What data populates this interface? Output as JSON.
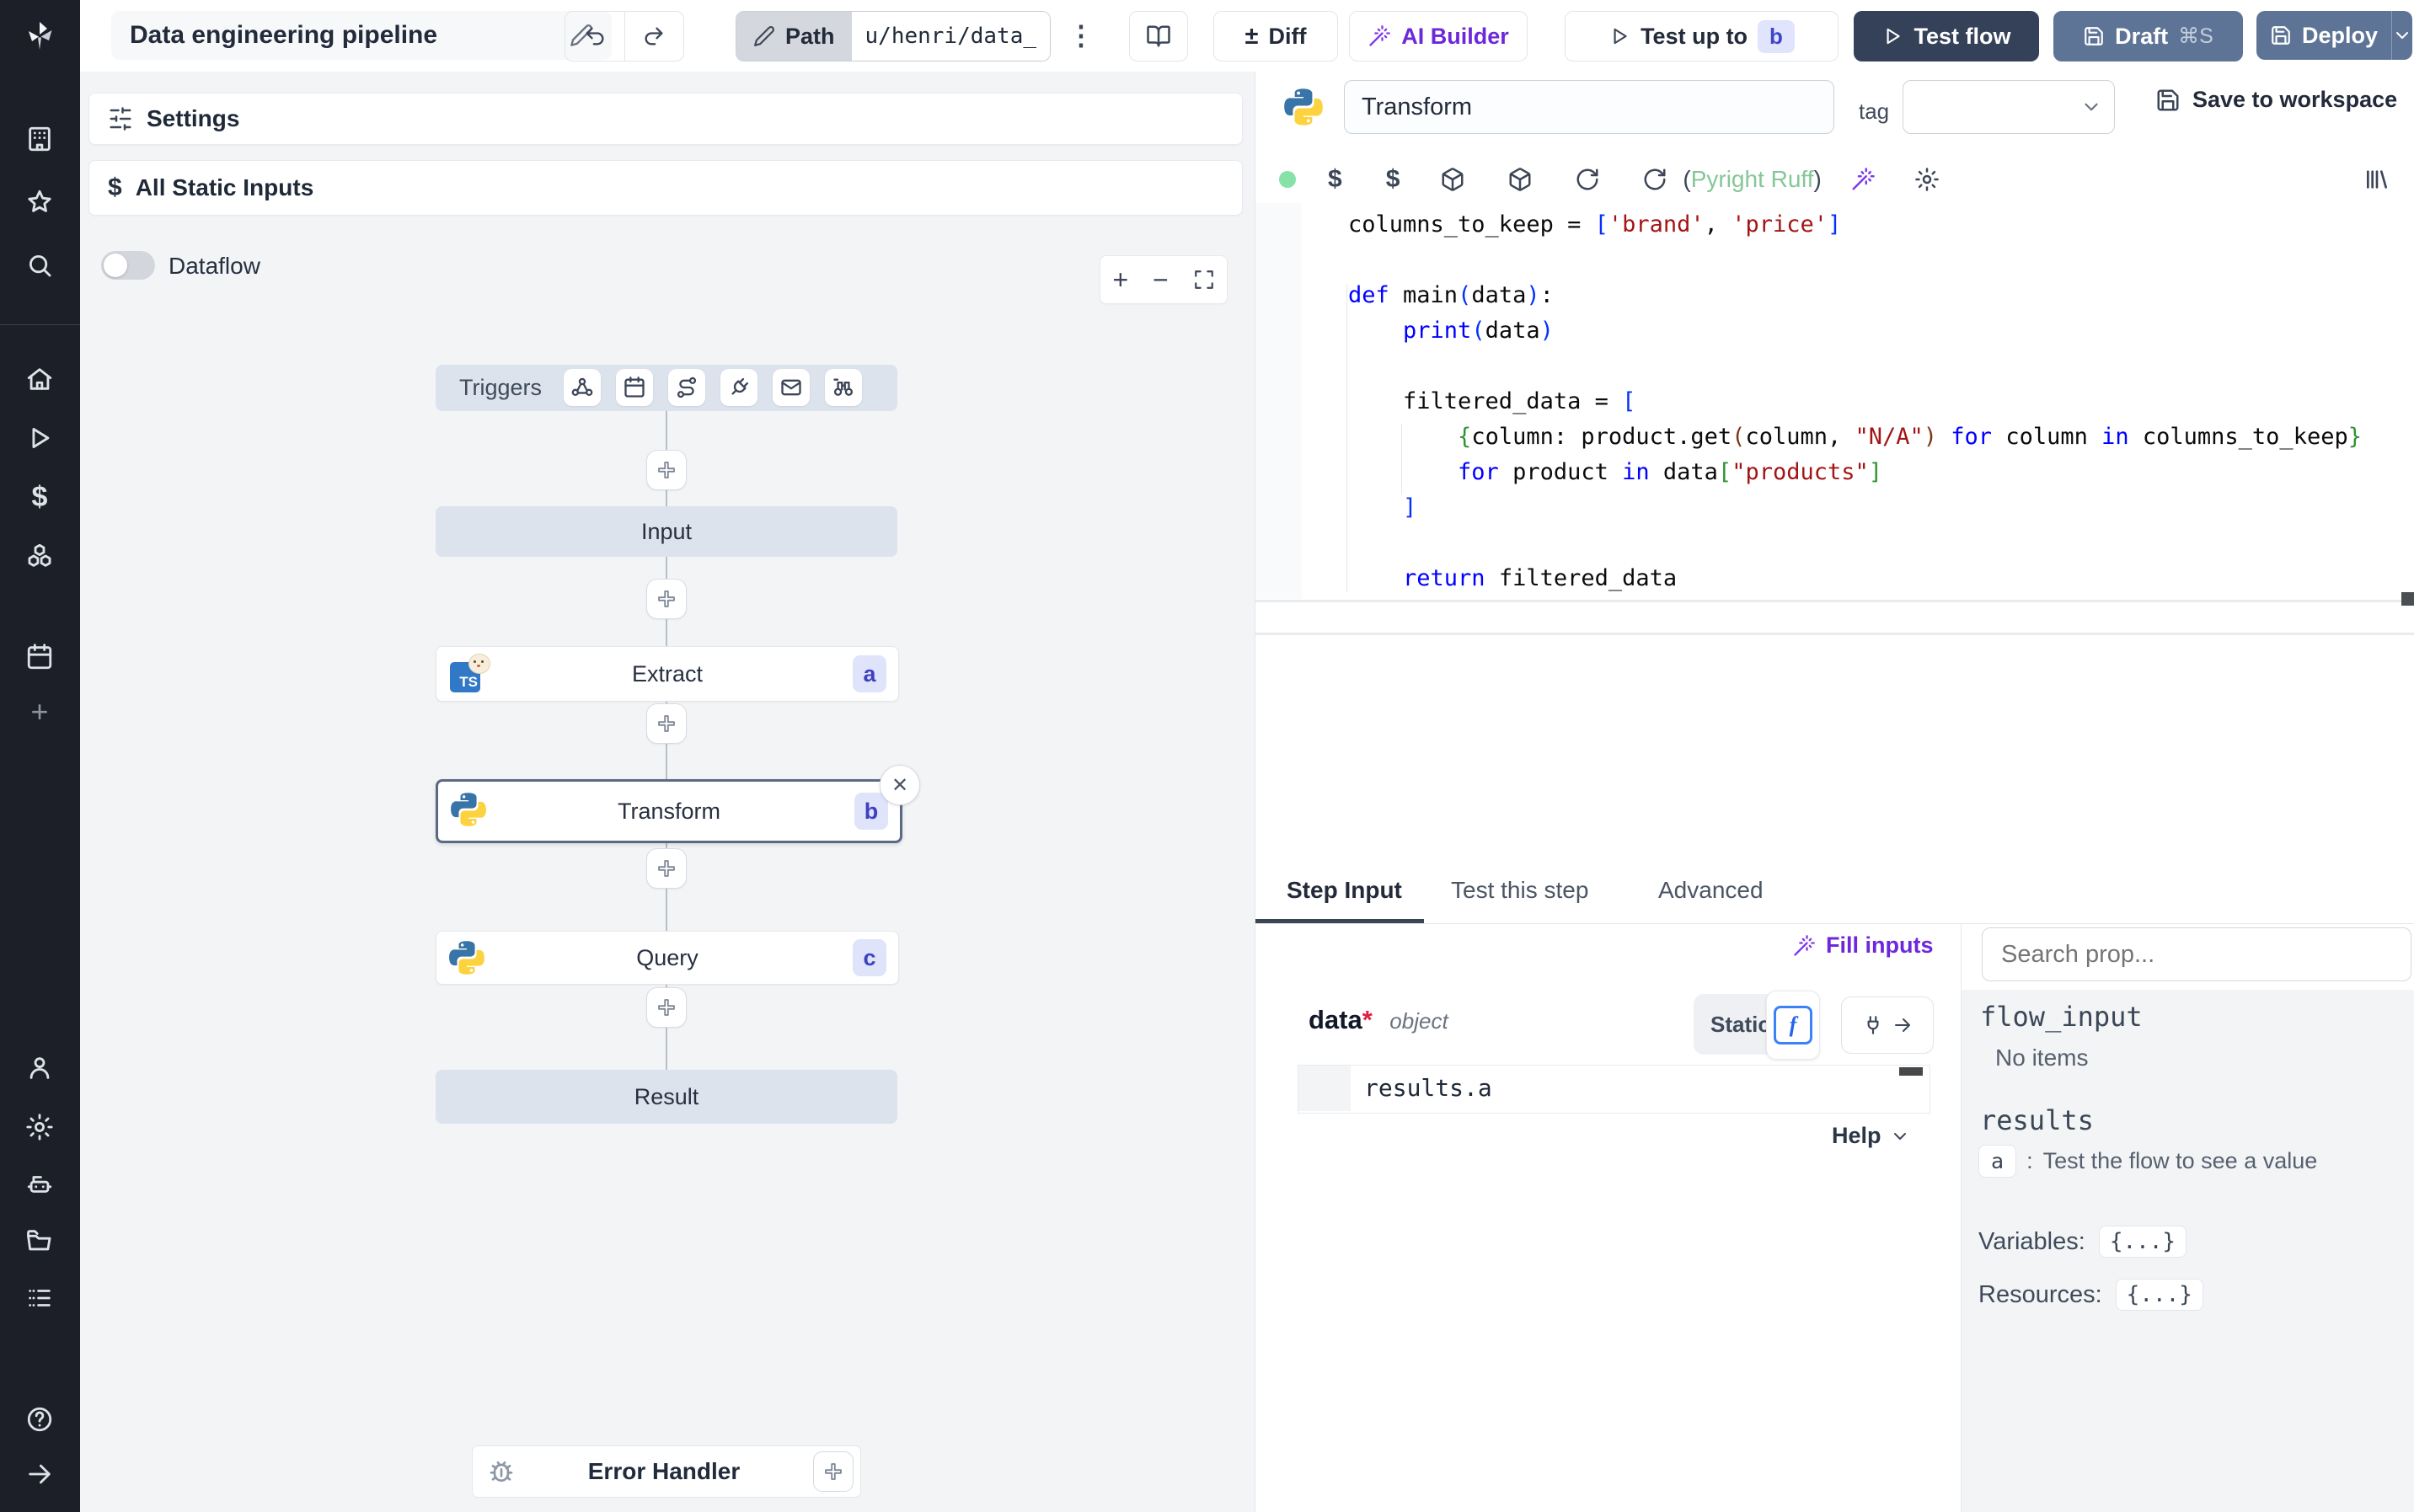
{
  "topbar": {
    "title": "Data engineering pipeline",
    "path_label": "Path",
    "path_value": "u/henri/data_",
    "diff": "Diff",
    "ai_builder": "AI Builder",
    "test_up_to": "Test up to",
    "test_up_to_badge": "b",
    "test_flow": "Test flow",
    "draft": "Draft",
    "draft_shortcut": "⌘S",
    "deploy": "Deploy"
  },
  "sidebar": {
    "icons": [
      "windmill-logo",
      "workspace-building",
      "favorites-star",
      "search",
      "home",
      "runs-play",
      "variables-dollar",
      "resources-cubes",
      "schedules-calendar",
      "add-plus",
      "user",
      "settings-gear",
      "workers-robot",
      "folders",
      "audit-list",
      "help",
      "expand-arrow"
    ]
  },
  "flow": {
    "settings": "Settings",
    "all_static_inputs": "All Static Inputs",
    "dataflow": "Dataflow",
    "triggers_label": "Triggers",
    "trigger_icons": [
      "webhook",
      "schedule-calendar",
      "http-route",
      "websocket-plug",
      "email",
      "scheduled-poll-binoculars"
    ],
    "nodes": {
      "input": "Input",
      "extract": "Extract",
      "extract_badge": "a",
      "transform": "Transform",
      "transform_badge": "b",
      "query": "Query",
      "query_badge": "c",
      "result": "Result"
    },
    "error_handler": "Error Handler"
  },
  "editor": {
    "step_name": "Transform",
    "tag_label": "tag",
    "save_label": "Save to workspace",
    "lint": {
      "open": "(",
      "text": "Pyright Ruff",
      "close": ")"
    },
    "code": [
      [
        [
          "p",
          "columns_to_keep = "
        ],
        [
          "b1",
          "["
        ],
        [
          "s",
          "'brand'"
        ],
        [
          "p",
          ", "
        ],
        [
          "s",
          "'price'"
        ],
        [
          "b1",
          "]"
        ]
      ],
      [],
      [
        [
          "k",
          "def"
        ],
        [
          "p",
          " main"
        ],
        [
          "b1",
          "("
        ],
        [
          "p",
          "data"
        ],
        [
          "b1",
          ")"
        ],
        [
          "p",
          ":"
        ]
      ],
      [
        [
          "p",
          "    "
        ],
        [
          "k",
          "print"
        ],
        [
          "b1",
          "("
        ],
        [
          "p",
          "data"
        ],
        [
          "b1",
          ")"
        ]
      ],
      [],
      [
        [
          "p",
          "    filtered_data = "
        ],
        [
          "b1",
          "["
        ]
      ],
      [
        [
          "p",
          "        "
        ],
        [
          "b2",
          "{"
        ],
        [
          "p",
          "column: product.get"
        ],
        [
          "b3",
          "("
        ],
        [
          "p",
          "column, "
        ],
        [
          "s",
          "\"N/A\""
        ],
        [
          "b3",
          ")"
        ],
        [
          "k",
          " for"
        ],
        [
          "p",
          " column "
        ],
        [
          "k",
          "in"
        ],
        [
          "p",
          " columns_to_keep"
        ],
        [
          "b2",
          "}"
        ]
      ],
      [
        [
          "p",
          "        "
        ],
        [
          "k",
          "for"
        ],
        [
          "p",
          " product "
        ],
        [
          "k",
          "in"
        ],
        [
          "p",
          " data"
        ],
        [
          "b2",
          "["
        ],
        [
          "s",
          "\"products\""
        ],
        [
          "b2",
          "]"
        ]
      ],
      [
        [
          "p",
          "    "
        ],
        [
          "b1",
          "]"
        ]
      ],
      [],
      [
        [
          "p",
          "    "
        ],
        [
          "k",
          "return"
        ],
        [
          "p",
          " filtered_data"
        ]
      ]
    ]
  },
  "tabs": {
    "step_input": "Step Input",
    "test_this_step": "Test this step",
    "advanced": "Advanced"
  },
  "step_input": {
    "fill_inputs": "Fill inputs",
    "arg_name": "data",
    "arg_required": "*",
    "arg_type": "object",
    "static_label": "Static",
    "f_icon": "f",
    "expr": "results.a",
    "help": "Help"
  },
  "props": {
    "search_placeholder": "Search prop...",
    "flow_input": "flow_input",
    "no_items": "No items",
    "results": "results",
    "result_key": "a",
    "colon": ":",
    "result_hint": "Test the flow to see a value",
    "variables_label": "Variables:",
    "resources_label": "Resources:",
    "braces": "{...}"
  },
  "colors": {
    "accent_purple": "#6d28d9",
    "test_flow_bg": "#344159",
    "slate_button_bg": "#5e7496",
    "badge_bg": "#dfe4fb",
    "badge_text": "#4040c0",
    "node_gray": "#dce3ed",
    "keyword": "#0000ff",
    "string": "#a31515",
    "lint_green": "#84c797",
    "status_dot_green": "#86e2a7"
  }
}
